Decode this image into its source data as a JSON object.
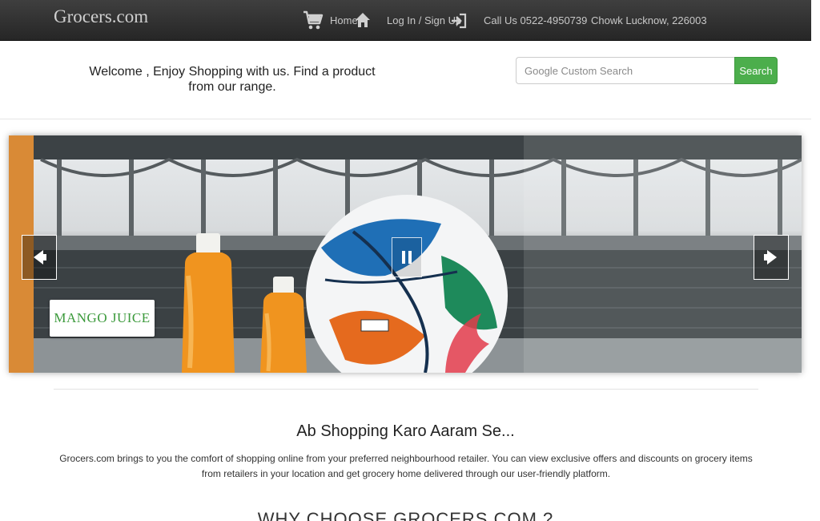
{
  "navbar": {
    "brand": "Grocers.com",
    "home": "Home",
    "login": "Log In / Sign Up",
    "call": "Call Us 0522-4950739",
    "location": "Chowk Lucknow, 226003",
    "icons": [
      "cart-icon",
      "home-icon",
      "login-icon"
    ]
  },
  "welcome": {
    "text": "Welcome , Enjoy Shopping with us. Find a product from our range."
  },
  "search": {
    "placeholder": "Google Custom Search",
    "button_label": "Search"
  },
  "carousel": {
    "caption": "MANGO JUICE",
    "controls": [
      "previous-arrow-icon",
      "pause-icon",
      "next-arrow-icon"
    ]
  },
  "content": {
    "tagline": "Ab Shopping Karo Aaram Se...",
    "intro": "Grocers.com brings to you the comfort of shopping online from your preferred neighbourhood retailer. You can view exclusive offers and discounts on grocery items from retailers in your location and get grocery home delivered through our user-friendly platform.",
    "why_heading": "WHY CHOOSE GROCERS.COM ?"
  },
  "colors": {
    "navbar": "#2e2e2e",
    "search_button": "#4cae4c",
    "caption_text": "#3c9a3c"
  }
}
